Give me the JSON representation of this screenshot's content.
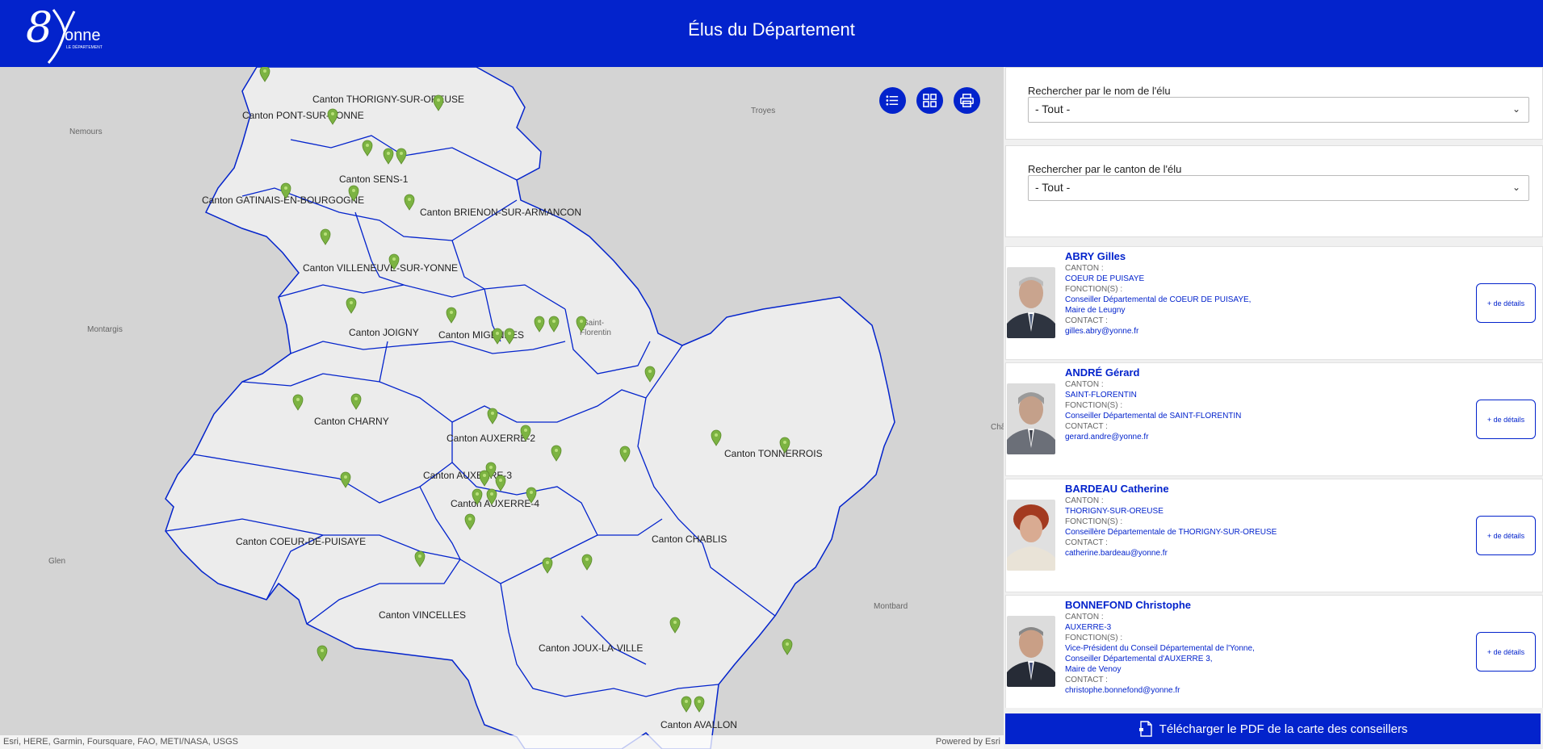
{
  "header": {
    "title": "Élus du Département",
    "logo_text": "89onne",
    "logo_sub": "LE DÉPARTEMENT",
    "bg_color": "#0323cc"
  },
  "map": {
    "attribution": "Esri, HERE, Garmin, Foursquare, FAO, METI/NASA, USGS",
    "powered_by": "Powered by Esri",
    "tools": [
      {
        "name": "list-icon"
      },
      {
        "name": "grid-icon"
      },
      {
        "name": "print-icon"
      }
    ],
    "places": [
      "Nemours",
      "Troyes",
      "Montargis",
      "Saint-Florentin",
      "Glen",
      "Montbard",
      "Châ"
    ],
    "cantons": [
      "Canton THORIGNY-SUR-OREUSE",
      "Canton PONT-SUR-YONNE",
      "Canton SENS-1",
      "Canton GATINAIS-EN-BOURGOGNE",
      "Canton BRIENON-SUR-ARMANCON",
      "Canton VILLENEUVE-SUR-YONNE",
      "Canton JOIGNY",
      "Canton MIGENNES",
      "Canton CHARNY",
      "Canton AUXERRE-2",
      "Canton AUXERRE-3",
      "Canton AUXERRE-4",
      "Canton TONNERROIS",
      "Canton COEUR-DE-PUISAYE",
      "Canton CHABLIS",
      "Canton VINCELLES",
      "Canton JOUX-LA-VILLE",
      "Canton AVALLON"
    ],
    "marker_color": "#7cb342",
    "boundary_color": "#0323cc"
  },
  "search": {
    "by_name_label": "Rechercher par le nom de l'élu",
    "by_name_value": "- Tout -",
    "by_canton_label": "Rechercher par le canton de l'élu",
    "by_canton_value": "- Tout -"
  },
  "labels": {
    "canton": "CANTON :",
    "fonctions": "FONCTION(S) :",
    "contact": "CONTACT :",
    "details": "+ de détails"
  },
  "elus": [
    {
      "name": "ABRY Gilles",
      "canton": "COEUR DE PUISAYE",
      "fonctions": [
        "Conseiller Départemental de COEUR DE PUISAYE,",
        "Maire de Leugny"
      ],
      "contact": "gilles.abry@yonne.fr"
    },
    {
      "name": "ANDRÉ Gérard",
      "canton": "SAINT-FLORENTIN",
      "fonctions": [
        "Conseiller Départemental de SAINT-FLORENTIN"
      ],
      "contact": "gerard.andre@yonne.fr"
    },
    {
      "name": "BARDEAU Catherine",
      "canton": "THORIGNY-SUR-OREUSE",
      "fonctions": [
        "Conseillère Départementale de THORIGNY-SUR-OREUSE"
      ],
      "contact": "catherine.bardeau@yonne.fr"
    },
    {
      "name": "BONNEFOND Christophe",
      "canton": "AUXERRE-3",
      "fonctions": [
        "Vice-Président du Conseil Départemental de l'Yonne,",
        "Conseiller Départemental d'AUXERRE 3,",
        "Maire de Venoy"
      ],
      "contact": "christophe.bonnefond@yonne.fr"
    }
  ],
  "pdf_button": "Télécharger le PDF de la carte des conseillers"
}
